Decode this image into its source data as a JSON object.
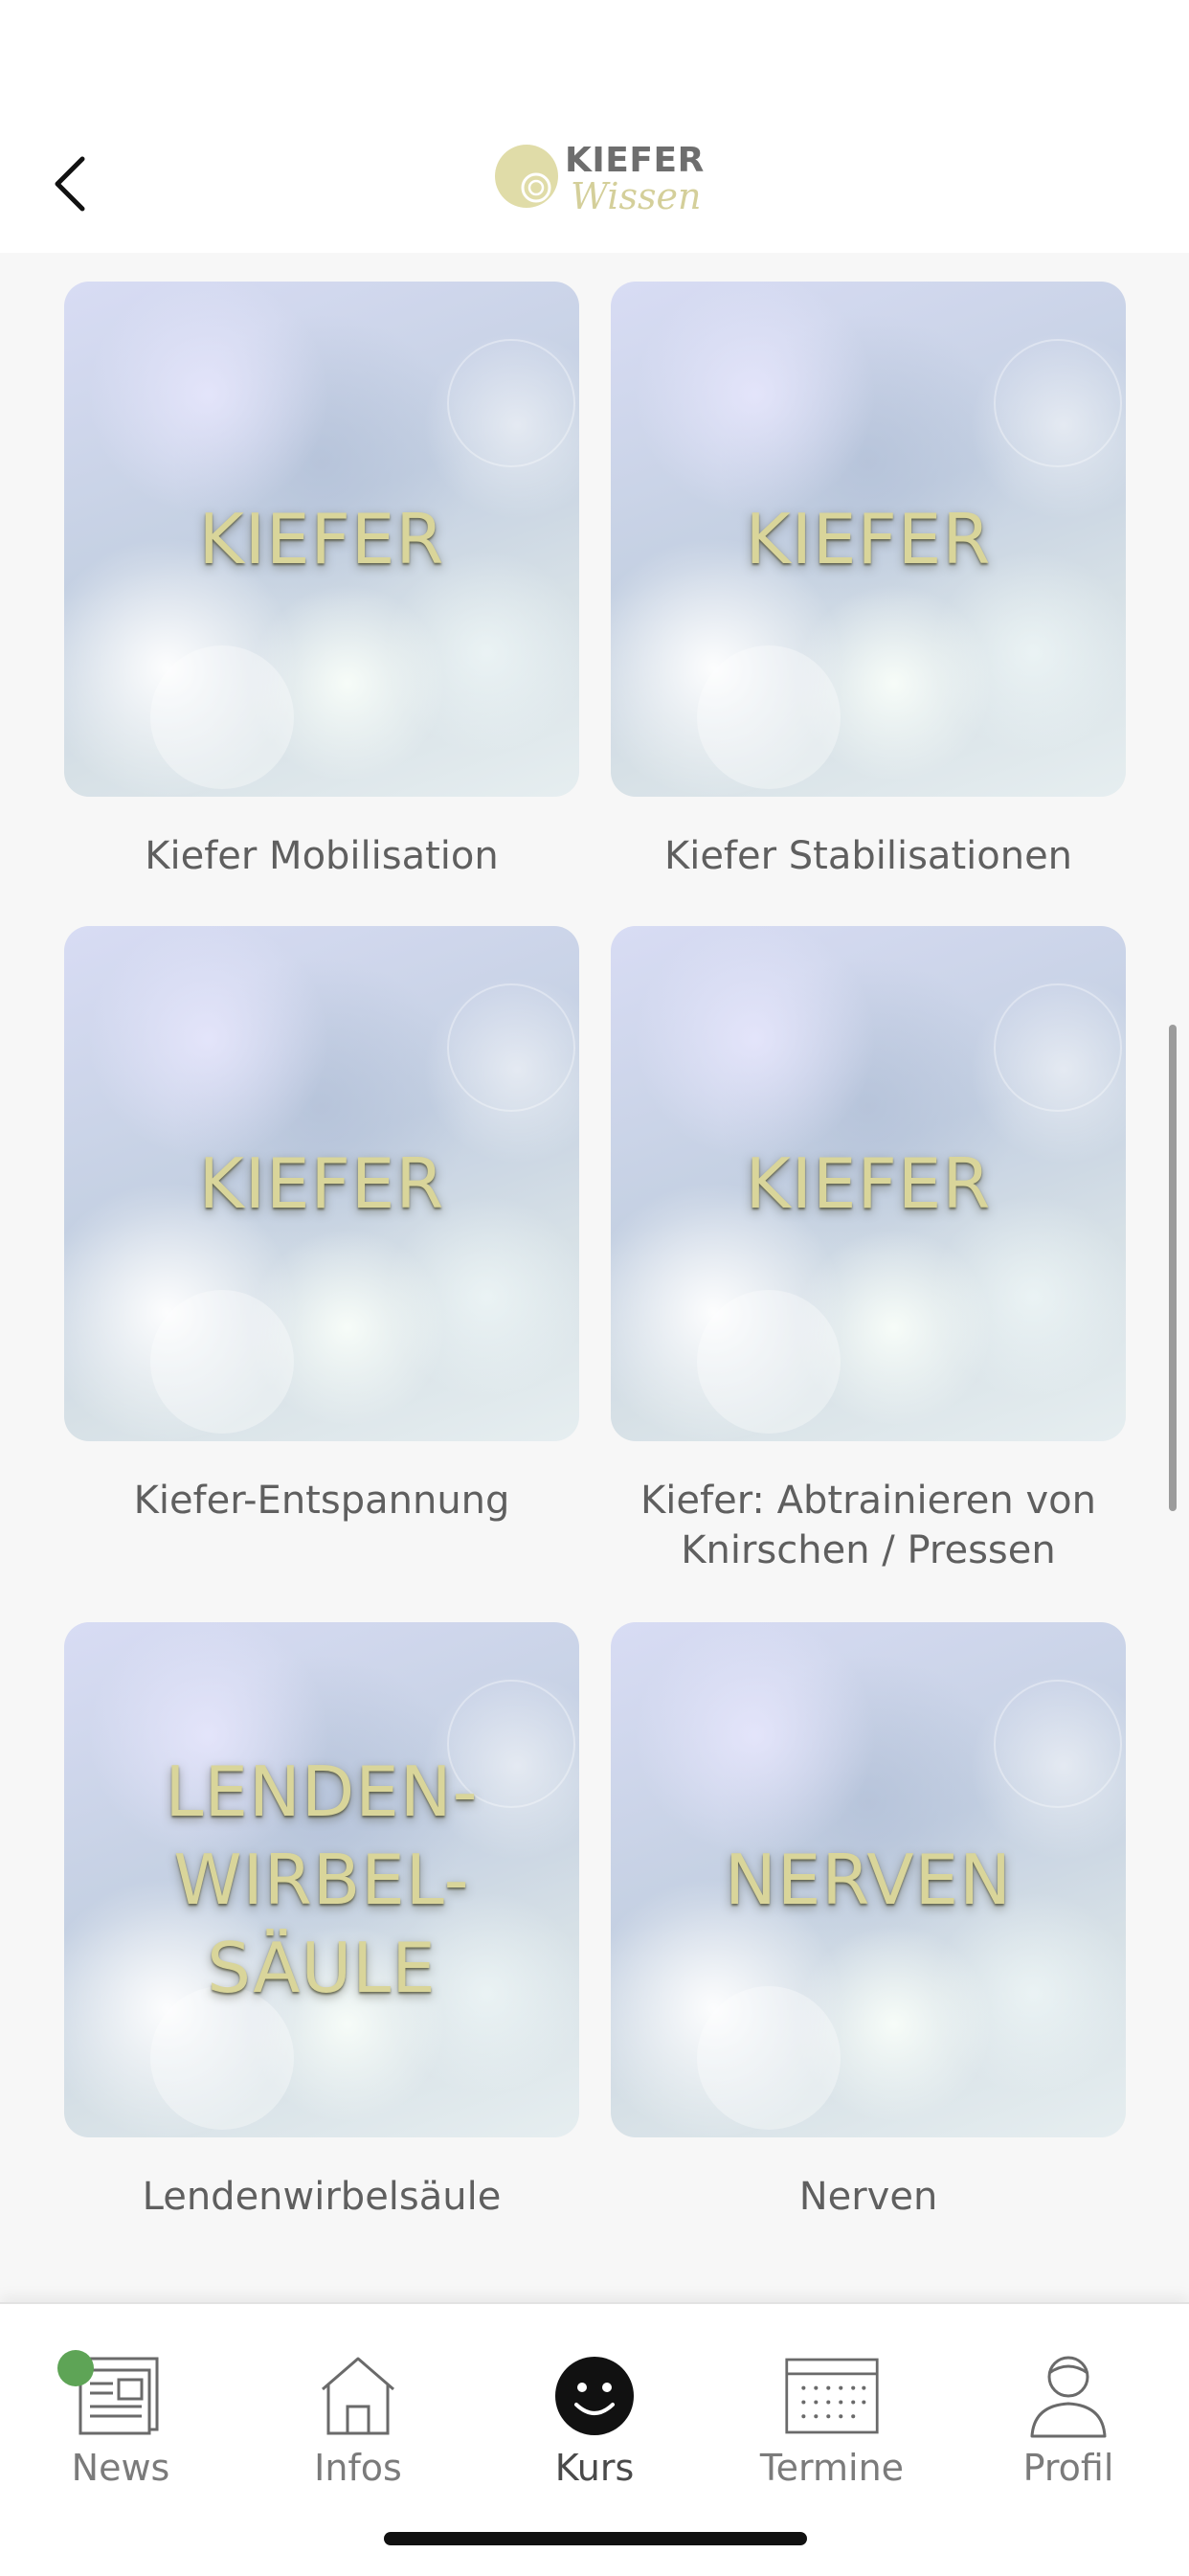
{
  "header": {
    "logo_word": "KIEFER",
    "logo_script": "Wissen"
  },
  "courses": [
    {
      "tile_text": "KIEFER",
      "caption": "Kiefer Mobilisation"
    },
    {
      "tile_text": "KIEFER",
      "caption": "Kiefer Stabilisationen"
    },
    {
      "tile_text": "KIEFER",
      "caption": "Kiefer-Entspannung"
    },
    {
      "tile_text": "KIEFER",
      "caption": "Kiefer: Abtrainieren von Knirschen / Pressen"
    },
    {
      "tile_text": "LENDEN-\nWIRBEL-\nSÄULE",
      "caption": "Lendenwirbelsäule"
    },
    {
      "tile_text": "NERVEN",
      "caption": "Nerven"
    }
  ],
  "tabbar": {
    "news": "News",
    "infos": "Infos",
    "kurs": "Kurs",
    "termine": "Termine",
    "profil": "Profil"
  },
  "colors": {
    "tile_text": "#d9d59a",
    "badge": "#5ea456",
    "logo_mark": "#e0dca8"
  }
}
